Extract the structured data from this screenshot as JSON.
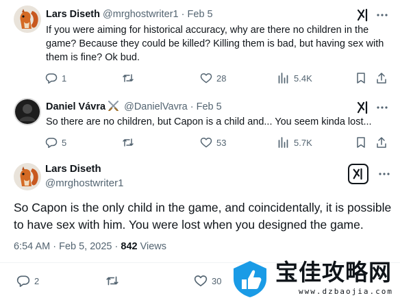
{
  "reply1": {
    "name": "Lars Diseth",
    "handle": "@mrghostwriter1",
    "sep": "·",
    "date": "Feb 5",
    "text": "If you were aiming for historical accuracy, why are there no children in the game? Because they could be killed? Killing them is bad, but having sex with them is fine? Ok bud.",
    "stats": {
      "replies": "1",
      "reposts": "",
      "likes": "28",
      "views": "5.4K"
    }
  },
  "reply2": {
    "name": "Daniel Vávra",
    "name_emoji": "crossed-swords",
    "handle": "@DanielVavra",
    "sep": "·",
    "date": "Feb 5",
    "text": "So there are no children, but Capon is a child and... You seem kinda lost...",
    "stats": {
      "replies": "5",
      "reposts": "",
      "likes": "53",
      "views": "5.7K"
    }
  },
  "main_tweet": {
    "name": "Lars Diseth",
    "handle": "@mrghostwriter1",
    "text": "So Capon is the only child in the game, and coincidentally, it is possible to have sex with him. You were lost when you designed the game.",
    "timestamp": "6:54 AM · Feb 5, 2025 · ",
    "views_count": "842",
    "views_label": " Views",
    "stats": {
      "replies": "2",
      "reposts": "",
      "likes": "30"
    }
  },
  "watermark": {
    "title": "宝佳攻略网",
    "url": "www.dzbaojia.com"
  },
  "colors": {
    "text_primary": "#0f1419",
    "text_secondary": "#536471",
    "divider": "#eff3f4",
    "watermark_blue": "#1a9be6"
  },
  "icons": {
    "reply": "reply-icon",
    "repost": "repost-icon",
    "like": "heart-icon",
    "views": "views-chart-icon",
    "bookmark": "bookmark-icon",
    "share": "share-icon",
    "grok": "grok-icon"
  }
}
